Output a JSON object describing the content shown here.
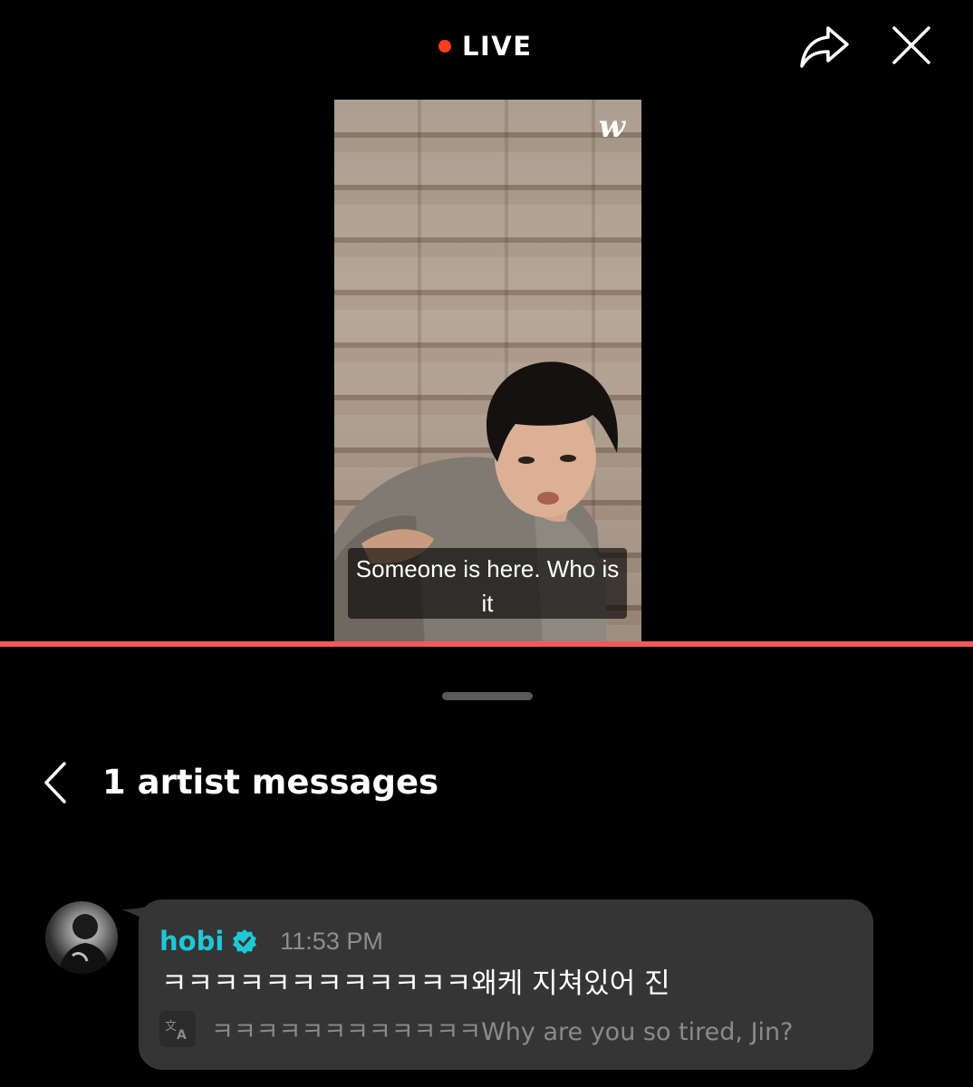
{
  "header": {
    "live_label": "LIVE",
    "live_dot_color": "#ff3b1f",
    "share_icon": "share-arrow-icon",
    "close_icon": "close-icon"
  },
  "video": {
    "watermark": "w",
    "caption": "Someone is here. Who is it"
  },
  "progress": {
    "fraction": 1.0,
    "color": "#f05a5a"
  },
  "sheet": {
    "back_icon": "chevron-left-icon",
    "title": "1 artist messages"
  },
  "messages": [
    {
      "author": "hobi",
      "verified": true,
      "time": "11:53 PM",
      "text": "ㅋㅋㅋㅋㅋㅋㅋㅋㅋㅋㅋㅋ왜케 지쳐있어 진",
      "translation": "ㅋㅋㅋㅋㅋㅋㅋㅋㅋㅋㅋㅋWhy are you so tired, Jin?",
      "author_color": "#1ec8d6",
      "translate_icon": "translate-icon"
    }
  ]
}
